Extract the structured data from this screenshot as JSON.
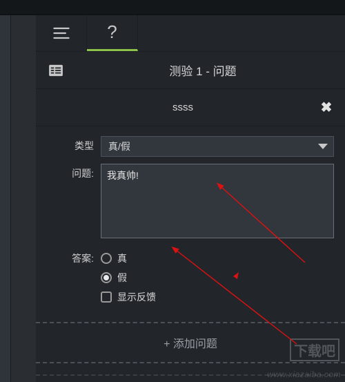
{
  "header": {
    "title": "测验 1 - 问题"
  },
  "question": {
    "collapse_title": "ssss",
    "type_label": "类型",
    "type_value": "真/假",
    "prompt_label": "问题:",
    "prompt_value": "我真帅!",
    "answer_label": "答案:",
    "options": {
      "true_label": "真",
      "false_label": "假",
      "selected": "false"
    },
    "show_feedback_label": "显示反馈"
  },
  "add_question_label": "+ 添加问题",
  "watermark": {
    "box": "下载吧",
    "url": "www.xiazaiba.com"
  }
}
